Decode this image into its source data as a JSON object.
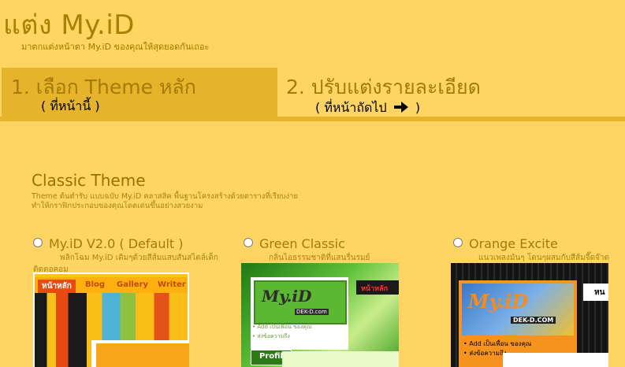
{
  "header": {
    "title": "แต่ง My.iD",
    "subtitle": "มาตกแต่งหน้าตา My.iD ของคุณให้สุดยอดกันเถอะ"
  },
  "steps": [
    {
      "title": "1. เลือก Theme หลัก",
      "sub": "( ที่หน้านี้ )",
      "active": true
    },
    {
      "title": "2. ปรับแต่งรายละเอียด",
      "sub_before": "( ที่หน้าถัดไป",
      "sub_after": ")",
      "icon": "arrow-right-icon",
      "active": false
    }
  ],
  "section": {
    "title": "Classic Theme",
    "desc_line1": "Theme ต้นตำรับ แบบฉบับ My.iD คลาสสิค พื้นฐานโครงสร้างด้วยตารางที่เรียบง่าย",
    "desc_line2": "ทำให้กราฟิกประกอบของคุณโดดเด่นขึ้นอย่างสวยงาม"
  },
  "themes": [
    {
      "name": "My.iD V2.0 ( Default )",
      "desc_line1": "พลิกโฉม My.iD เดิมๆด้วยสีส้มแสบสันสไตล์เด็ก",
      "desc_line2": "ติดตอคอม",
      "nav": [
        "หน้าหลัก",
        "Blog",
        "Gallery",
        "Writer"
      ],
      "selected": false
    },
    {
      "name": "Green Classic",
      "desc_line1": "กลิ่นไอธรรมชาติที่แสนรื่นรมย์",
      "logo": "My.iD",
      "logo_sub": "DEK-D.com",
      "mini_header": "หน้าหลัก",
      "links": [
        "Add เป็นเพื่อน ของคุณ",
        "ส่งข้อความถึง"
      ],
      "profile": "Profil",
      "selected": false
    },
    {
      "name": "Orange Excite",
      "desc_line1": "แนวเพลงมันๆ โดนๆผสมกับสีส้มจี๊ดจ๊าด",
      "logo": "My.iD",
      "logo_sub": "DEK-D.COM",
      "mini_header": "หน",
      "links": [
        "Add เป็นเพื่อน ของคุณ",
        "ส่งข้อความถึง"
      ],
      "selected": false
    }
  ],
  "colors": {
    "background": "#fed462",
    "active_step": "#e6b42a",
    "title_text": "#a97f06"
  }
}
